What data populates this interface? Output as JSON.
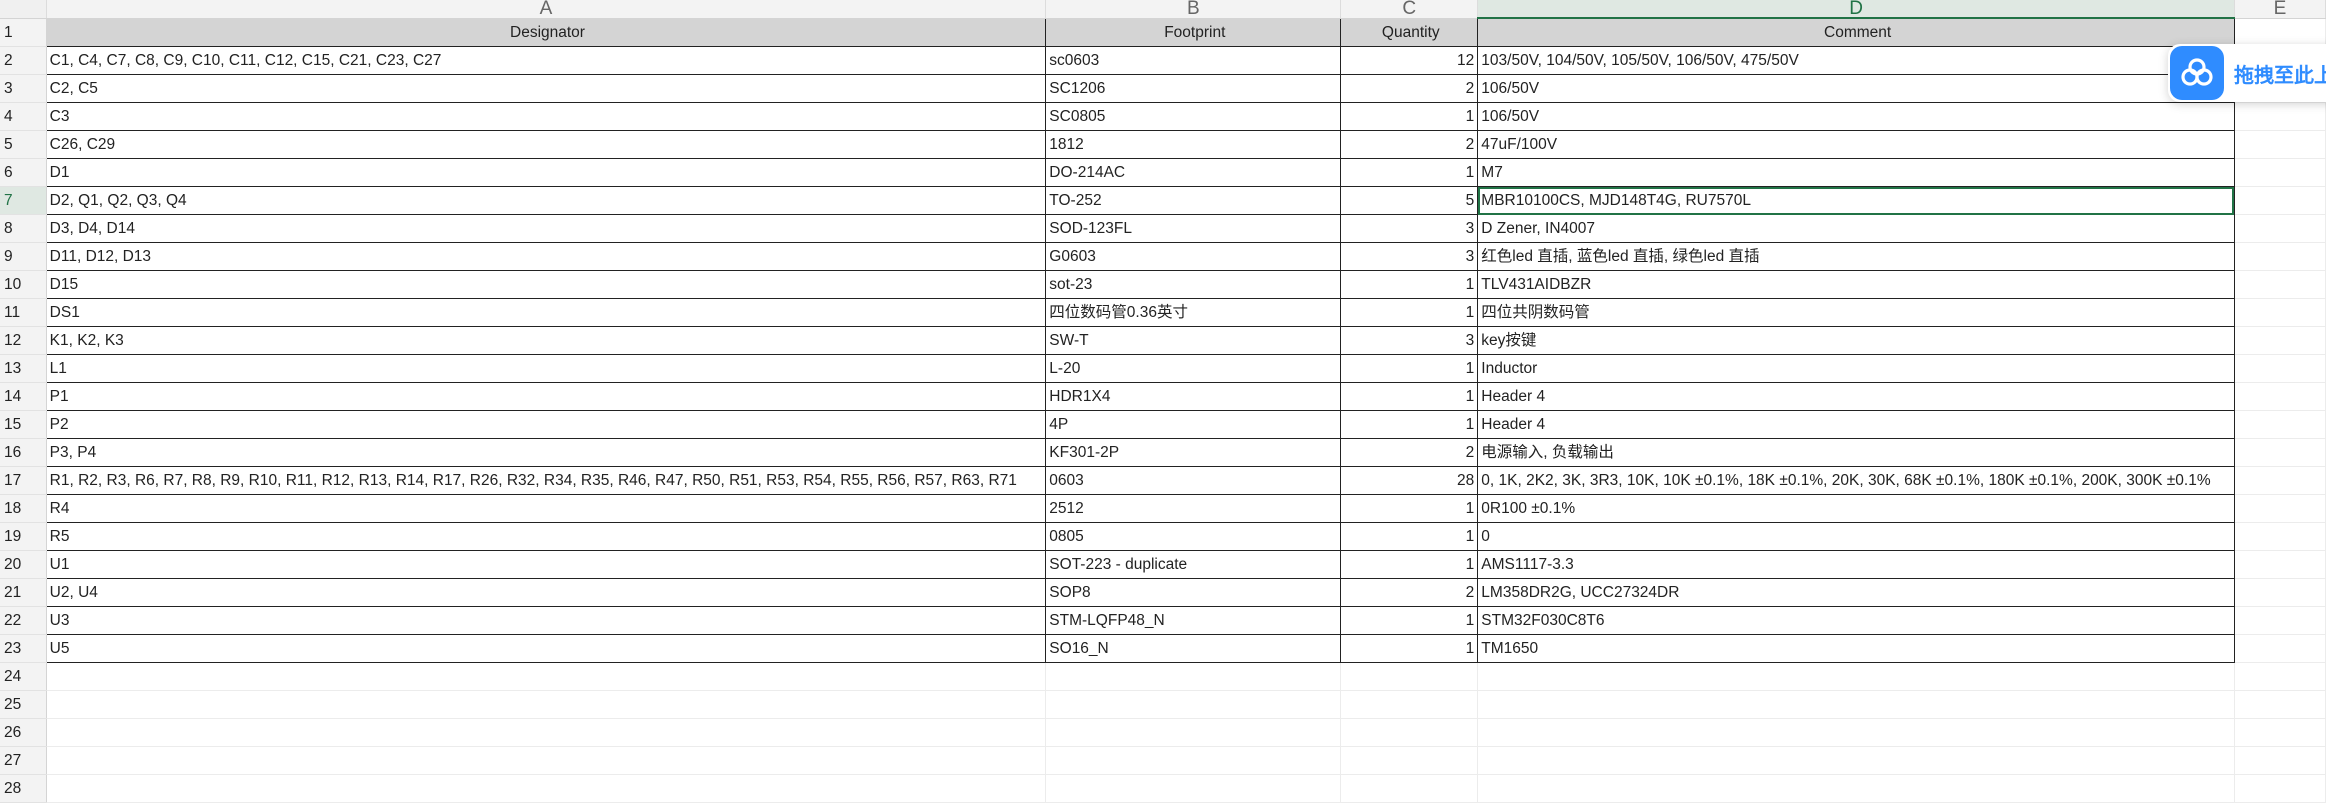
{
  "columns": [
    "A",
    "B",
    "C",
    "D",
    "E"
  ],
  "header": {
    "row": "1",
    "designator": "Designator",
    "footprint": "Footprint",
    "quantity": "Quantity",
    "comment": "Comment"
  },
  "rows": [
    {
      "n": "2",
      "a": "C1, C4, C7, C8, C9, C10, C11, C12, C15, C21, C23, C27",
      "b": "sc0603",
      "c": "12",
      "d": "103/50V, 104/50V, 105/50V, 106/50V, 475/50V"
    },
    {
      "n": "3",
      "a": "C2, C5",
      "b": "SC1206",
      "c": "2",
      "d": "106/50V"
    },
    {
      "n": "4",
      "a": "C3",
      "b": "SC0805",
      "c": "1",
      "d": "106/50V"
    },
    {
      "n": "5",
      "a": "C26, C29",
      "b": "1812",
      "c": "2",
      "d": "47uF/100V"
    },
    {
      "n": "6",
      "a": "D1",
      "b": "DO-214AC",
      "c": "1",
      "d": "M7"
    },
    {
      "n": "7",
      "a": "D2, Q1, Q2, Q3, Q4",
      "b": "TO-252",
      "c": "5",
      "d": "MBR10100CS, MJD148T4G, RU7570L"
    },
    {
      "n": "8",
      "a": "D3, D4, D14",
      "b": "SOD-123FL",
      "c": "3",
      "d": "D Zener, IN4007"
    },
    {
      "n": "9",
      "a": "D11, D12, D13",
      "b": "G0603",
      "c": "3",
      "d": "红色led 直插, 蓝色led 直插, 绿色led 直插"
    },
    {
      "n": "10",
      "a": "D15",
      "b": "sot-23",
      "c": "1",
      "d": "TLV431AIDBZR"
    },
    {
      "n": "11",
      "a": "DS1",
      "b": "四位数码管0.36英寸",
      "c": "1",
      "d": "四位共阴数码管"
    },
    {
      "n": "12",
      "a": "K1, K2, K3",
      "b": "SW-T",
      "c": "3",
      "d": "key按键"
    },
    {
      "n": "13",
      "a": "L1",
      "b": "L-20",
      "c": "1",
      "d": "Inductor"
    },
    {
      "n": "14",
      "a": "P1",
      "b": "HDR1X4",
      "c": "1",
      "d": "Header 4"
    },
    {
      "n": "15",
      "a": "P2",
      "b": "4P",
      "c": "1",
      "d": "Header 4"
    },
    {
      "n": "16",
      "a": "P3, P4",
      "b": "KF301-2P",
      "c": "2",
      "d": "电源输入, 负载输出"
    },
    {
      "n": "17",
      "a": "R1, R2, R3, R6, R7, R8, R9, R10, R11, R12, R13, R14, R17, R26, R32, R34, R35, R46, R47, R50, R51, R53, R54, R55, R56, R57, R63, R71",
      "b": "0603",
      "c": "28",
      "d": "0, 1K, 2K2, 3K, 3R3, 10K, 10K ±0.1%, 18K ±0.1%, 20K, 30K, 68K ±0.1%, 180K ±0.1%, 200K, 300K ±0.1%"
    },
    {
      "n": "18",
      "a": "R4",
      "b": "2512",
      "c": "1",
      "d": "0R100 ±0.1%"
    },
    {
      "n": "19",
      "a": "R5",
      "b": "0805",
      "c": "1",
      "d": "0"
    },
    {
      "n": "20",
      "a": "U1",
      "b": "SOT-223 - duplicate",
      "c": "1",
      "d": "AMS1117-3.3"
    },
    {
      "n": "21",
      "a": "U2, U4",
      "b": "SOP8",
      "c": "2",
      "d": "LM358DR2G, UCC27324DR"
    },
    {
      "n": "22",
      "a": "U3",
      "b": "STM-LQFP48_N",
      "c": "1",
      "d": "STM32F030C8T6"
    },
    {
      "n": "23",
      "a": "U5",
      "b": "SO16_N",
      "c": "1",
      "d": "TM1650"
    }
  ],
  "empty_rows": [
    "24",
    "25",
    "26",
    "27",
    "28"
  ],
  "widget": {
    "label": "拖拽至此上",
    "icon": "cloud-upload-icon",
    "color": "#2f8cff"
  },
  "accent_color": "#217346"
}
